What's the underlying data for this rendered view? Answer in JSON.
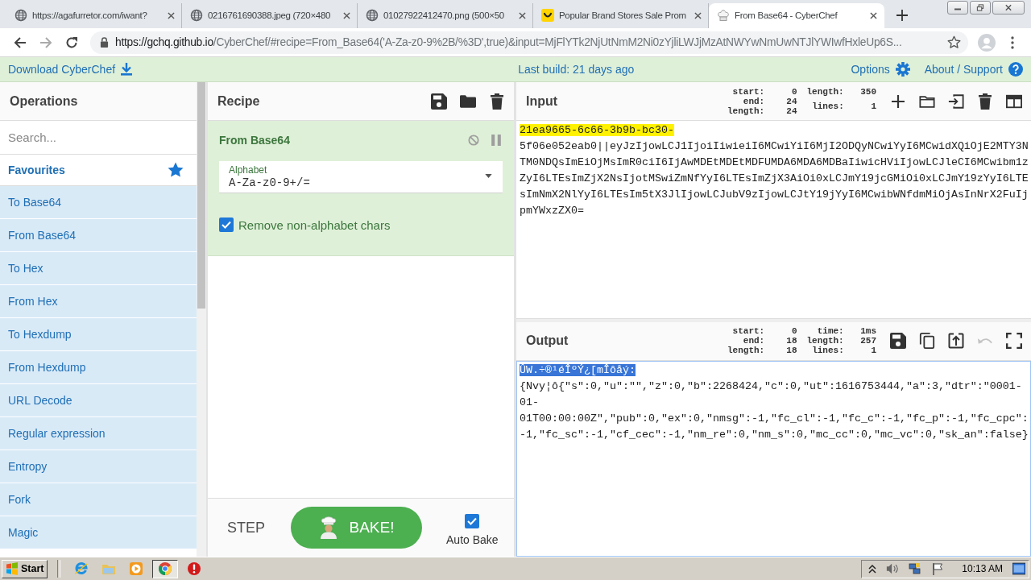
{
  "browser": {
    "tabs": [
      {
        "title": "https://agafurretor.com/iwant?",
        "kind": "globe",
        "selected": false
      },
      {
        "title": "0216761690388.jpeg (720×480",
        "kind": "globe",
        "selected": false
      },
      {
        "title": "01027922412470.png (500×50",
        "kind": "globe",
        "selected": false
      },
      {
        "title": "Popular Brand Stores Sale Prom",
        "kind": "smile",
        "selected": false
      },
      {
        "title": "From Base64 - CyberChef",
        "kind": "chef",
        "selected": true
      }
    ],
    "address": {
      "host": "https://gchq.github.io",
      "path": "/CyberChef/#recipe=From_Base64('A-Za-z0-9%2B/%3D',true)&input=MjFlYTk2NjUtNmM2Ni0zYjliLWJjMzAtNWYwNmUwNTJlYWIwfHxleUp6S..."
    }
  },
  "banner": {
    "download": "Download CyberChef",
    "build": "Last build: 21 days ago",
    "options": "Options",
    "about": "About / Support"
  },
  "operations": {
    "title": "Operations",
    "search": {
      "placeholder": "Search..."
    },
    "favourites": "Favourites",
    "items": [
      "To Base64",
      "From Base64",
      "To Hex",
      "From Hex",
      "To Hexdump",
      "From Hexdump",
      "URL Decode",
      "Regular expression",
      "Entropy",
      "Fork",
      "Magic"
    ]
  },
  "recipe": {
    "title": "Recipe",
    "operations": [
      {
        "name": "From Base64",
        "args": [
          {
            "kind": "dropdown",
            "label": "Alphabet",
            "value": "A-Za-z0-9+/="
          },
          {
            "kind": "checkbox",
            "label": "Remove non-alphabet chars",
            "checked": true
          }
        ]
      }
    ],
    "step": "STEP",
    "bake": "BAKE!",
    "auto_bake": {
      "label": "Auto Bake",
      "checked": true
    }
  },
  "input": {
    "title": "Input",
    "stats": [
      [
        {
          "label": "start:",
          "value": "0"
        },
        {
          "label": "end:",
          "value": "24"
        },
        {
          "label": "length:",
          "value": "24"
        }
      ],
      [
        {
          "label": "length:",
          "value": "350"
        },
        {
          "label": "lines:",
          "value": "1"
        }
      ]
    ],
    "tools": [
      {
        "kind": "add"
      },
      {
        "kind": "open"
      },
      {
        "kind": "load"
      },
      {
        "kind": "delete"
      },
      {
        "kind": "layout"
      }
    ],
    "selection": "21ea9665-6c66-3b9b-bc30-",
    "text": "5f06e052eab0||eyJzIjowLCJ1IjoiIiwieiI6MCwiYiI6MjI2ODQyNCwiYyI6MCwidXQiOjE2MTY3NTM0NDQsImEiOjMsImR0ciI6IjAwMDEtMDEtMDFUMDA6MDA6MDBaIiwicHViIjowLCJleCI6MCwibm1zZyI6LTEsImZjX2NsIjotMSwiZmNfYyI6LTEsImZjX3AiOi0xLCJmY19jcGMiOi0xLCJmY19zYyI6LTEsImNmX2NlYyI6LTEsIm5tX3JlIjowLCJubV9zIjowLCJtY19jYyI6MCwibWNfdmMiOjAsInNrX2FuIjpmYWxzZX0="
  },
  "output": {
    "title": "Output",
    "stats": [
      [
        {
          "label": "start:",
          "value": "0"
        },
        {
          "label": "end:",
          "value": "18"
        },
        {
          "label": "length:",
          "value": "18"
        }
      ],
      [
        {
          "label": "time:",
          "value": "1ms"
        },
        {
          "label": "length:",
          "value": "257"
        },
        {
          "label": "lines:",
          "value": "1"
        }
      ]
    ],
    "tools": [
      {
        "kind": "save",
        "disabled": false
      },
      {
        "kind": "copy",
        "disabled": false
      },
      {
        "kind": "replace",
        "disabled": false
      },
      {
        "kind": "undo",
        "disabled": true
      },
      {
        "kind": "maximize",
        "disabled": false
      }
    ],
    "selection": "ÛW.÷®¹éÎºÝ¿[mÎôåý:",
    "text": "{Nvy¦ô{\"s\":0,\"u\":\"\",\"z\":0,\"b\":2268424,\"c\":0,\"ut\":1616753444,\"a\":3,\"dtr\":\"0001-01-01T00:00:00Z\",\"pub\":0,\"ex\":0,\"nmsg\":-1,\"fc_cl\":-1,\"fc_c\":-1,\"fc_p\":-1,\"fc_cpc\":-1,\"fc_sc\":-1,\"cf_cec\":-1,\"nm_re\":0,\"nm_s\":0,\"mc_cc\":0,\"mc_vc\":0,\"sk_an\":false}"
  },
  "taskbar": {
    "start": "Start",
    "clock": "10:13 AM"
  }
}
